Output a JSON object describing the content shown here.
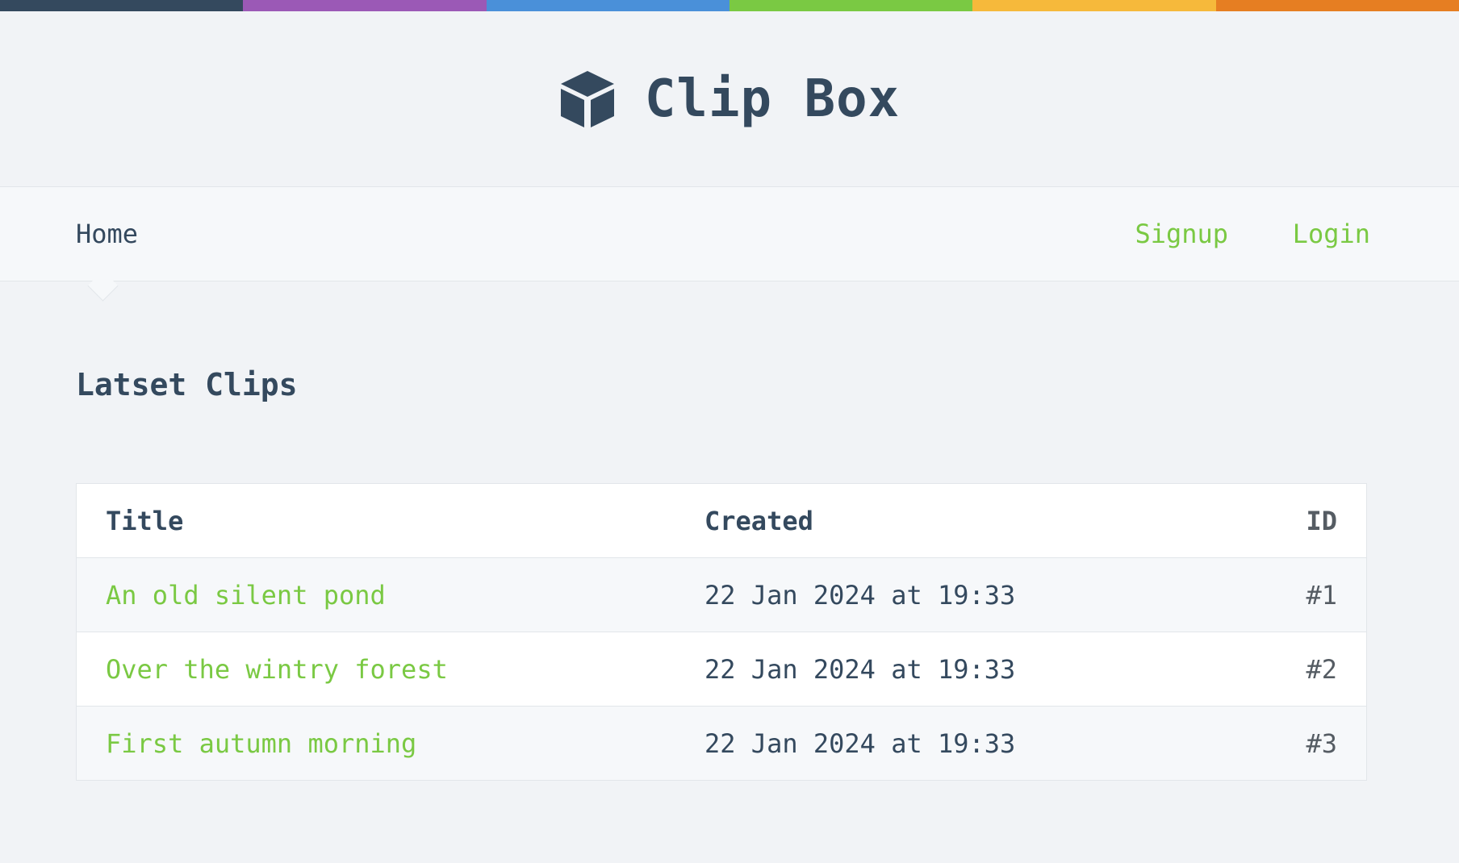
{
  "stripe_colors": [
    "#34495e",
    "#9b59b6",
    "#4a90d9",
    "#7ac943",
    "#f6b93b",
    "#e67e22"
  ],
  "brand": {
    "title": "Clip Box",
    "logo_icon": "cube-icon"
  },
  "nav": {
    "home_label": "Home",
    "signup_label": "Signup",
    "login_label": "Login"
  },
  "main": {
    "heading": "Latset Clips",
    "table": {
      "headers": {
        "title": "Title",
        "created": "Created",
        "id": "ID"
      },
      "rows": [
        {
          "title": "An old silent pond",
          "created": "22 Jan 2024 at 19:33",
          "id": "#1"
        },
        {
          "title": "Over the wintry forest",
          "created": "22 Jan 2024 at 19:33",
          "id": "#2"
        },
        {
          "title": "First autumn morning",
          "created": "22 Jan 2024 at 19:33",
          "id": "#3"
        }
      ]
    }
  },
  "colors": {
    "accent": "#7ac943",
    "text": "#34495e",
    "background": "#f1f3f6"
  }
}
